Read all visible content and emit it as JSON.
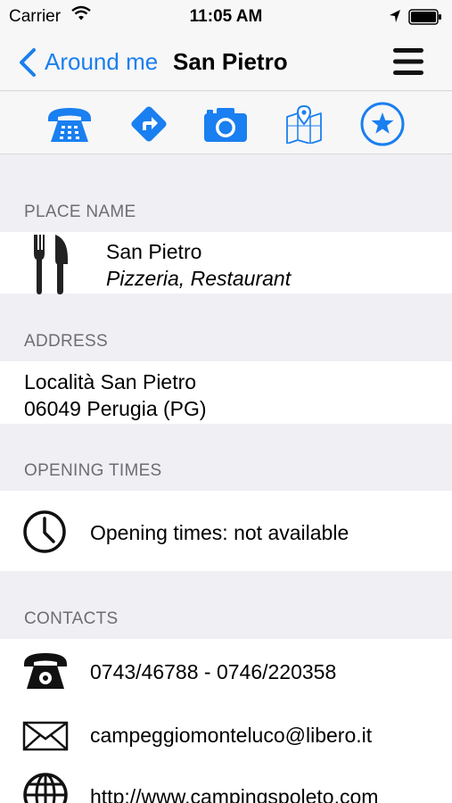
{
  "status_bar": {
    "carrier": "Carrier",
    "time": "11:05 AM"
  },
  "nav": {
    "back_label": "Around me",
    "title": "San Pietro"
  },
  "toolbar": {
    "icons": [
      "phone-icon",
      "directions-icon",
      "camera-icon",
      "map-icon",
      "favorite-star-icon"
    ],
    "accent_color": "#1a7ff0"
  },
  "sections": {
    "place_name": {
      "header": "PLACE NAME",
      "name": "San Pietro",
      "category": "Pizzeria, Restaurant"
    },
    "address": {
      "header": "ADDRESS",
      "line1": "Località San Pietro",
      "line2": "06049 Perugia (PG)"
    },
    "opening_times": {
      "header": "OPENING TIMES",
      "value": "Opening times: not available"
    },
    "contacts": {
      "header": "CONTACTS",
      "phone": "0743/46788 - 0746/220358",
      "email": "campeggiomonteluco@libero.it",
      "website": "http://www.campingspoleto.com"
    }
  }
}
